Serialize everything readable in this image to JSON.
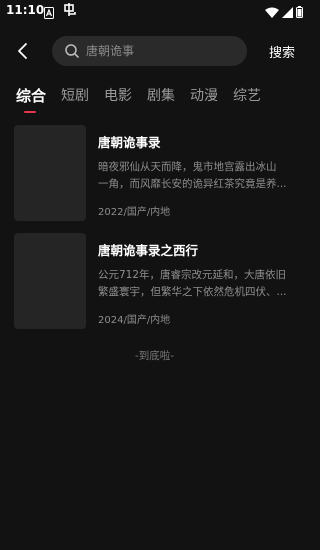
{
  "status_bar": {
    "time": "11:10",
    "icons": [
      "a-notification-icon",
      "app-notification-icon",
      "wifi-icon",
      "signal-icon",
      "battery-icon"
    ]
  },
  "header": {
    "search_placeholder": "唐朝诡事",
    "search_button": "搜索"
  },
  "tabs": [
    {
      "label": "综合",
      "active": true
    },
    {
      "label": "短剧",
      "active": false
    },
    {
      "label": "电影",
      "active": false
    },
    {
      "label": "剧集",
      "active": false
    },
    {
      "label": "动漫",
      "active": false
    },
    {
      "label": "综艺",
      "active": false
    }
  ],
  "results": [
    {
      "title": "唐朝诡事录",
      "desc_line1": "暗夜邪仙从天而降，鬼市地宫露出冰山",
      "desc_line2": "一角，而风靡长安的诡异红茶究竟是养...",
      "meta": "2022/国产/内地"
    },
    {
      "title": "唐朝诡事录之西行",
      "desc_line1": "公元712年，唐睿宗改元延和，大唐依旧",
      "desc_line2": "繁盛寰宇，但繁华之下依然危机四伏、...",
      "meta": "2024/国产/内地"
    }
  ],
  "footer": {
    "end_text": "-到底啦-"
  },
  "colors": {
    "background": "#121212",
    "accent": "#e8334a",
    "search_bg": "#2a2a2a",
    "poster_bg": "#252525"
  }
}
